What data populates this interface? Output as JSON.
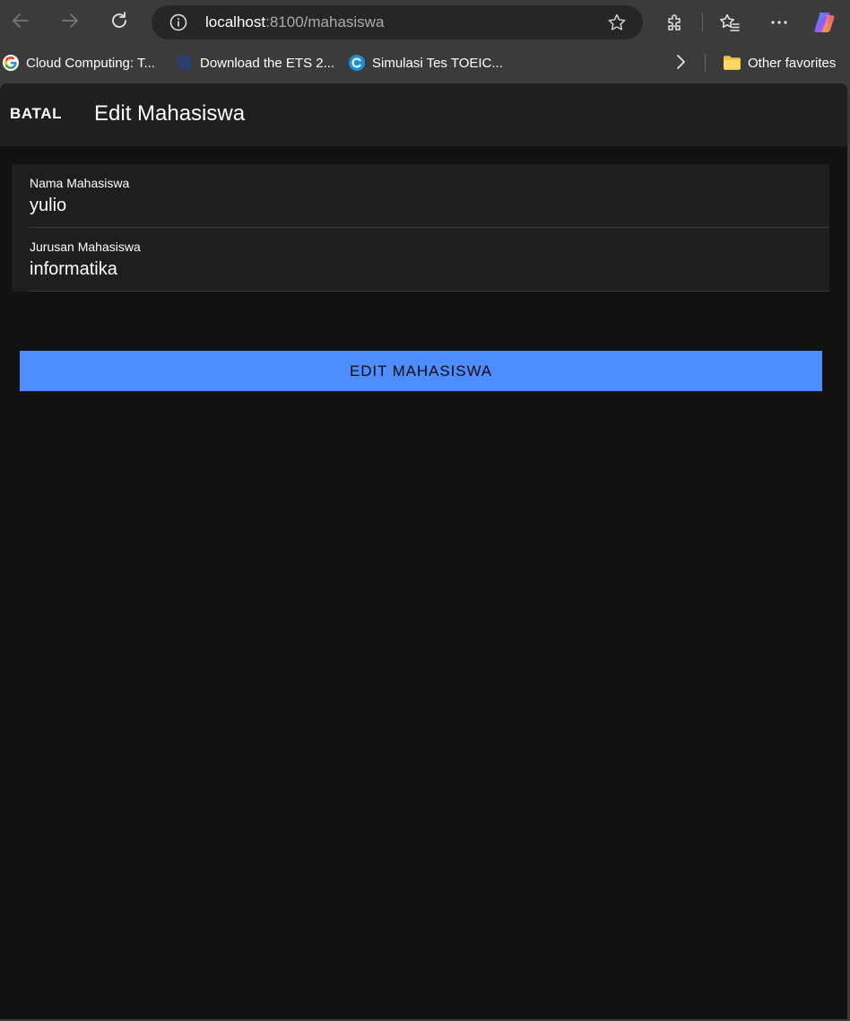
{
  "browser": {
    "url_host": "localhost",
    "url_path": ":8100/mahasiswa",
    "icons": {
      "back": "arrow-left-icon",
      "forward": "arrow-right-icon",
      "refresh": "refresh-icon",
      "site_info": "info-icon",
      "favorite": "star-icon",
      "extensions": "puzzle-icon",
      "favorites_list": "favorites-icon",
      "more": "ellipsis-icon",
      "copilot": "copilot-icon"
    }
  },
  "bookmarks": {
    "items": [
      {
        "label": "Cloud Computing: T...",
        "icon": "google-icon"
      },
      {
        "label": "Download the ETS 2...",
        "icon": "globe-icon"
      },
      {
        "label": "Simulasi Tes TOEIC...",
        "icon": "c-logo-icon"
      }
    ],
    "other_favorites": "Other favorites"
  },
  "app": {
    "header": {
      "back_label": "BATAL",
      "title": "Edit Mahasiswa"
    },
    "form": {
      "name_label": "Nama Mahasiswa",
      "name_value": "yulio",
      "major_label": "Jurusan Mahasiswa",
      "major_value": "informatika"
    },
    "submit_label": "EDIT MAHASISWA"
  },
  "colors": {
    "accent": "#4d8dff",
    "background": "#121212",
    "toolbar": "#1f1f1f",
    "browser_chrome": "#3b3b3b"
  }
}
